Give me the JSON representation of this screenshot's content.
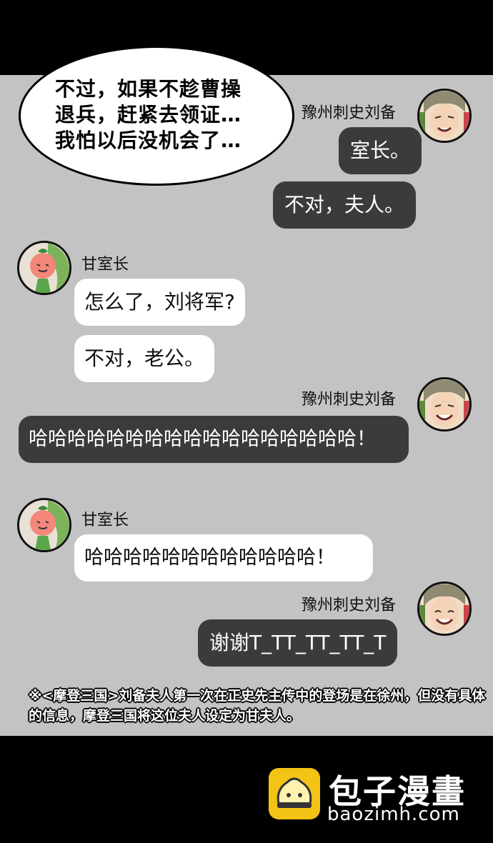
{
  "speech_bubble": {
    "text": "不过，如果不趁曹操\n退兵，赶紧去领证…\n我怕以后没机会了…"
  },
  "chat": {
    "liu_bei_name": "豫州刺史刘备",
    "gan_name": "甘室长",
    "messages": [
      "室长。",
      "不对，夫人。",
      "怎么了，刘将军?",
      "不对，老公。",
      "哈哈哈哈哈哈哈哈哈哈哈哈哈哈哈哈哈！",
      "哈哈哈哈哈哈哈哈哈哈哈哈！",
      "谢谢T_TT_TT_TT_T"
    ]
  },
  "footnote": "※<摩登三国>刘备夫人第一次在正史先主传中的登场是在徐州，但没有具体的信息，摩登三国将这位夫人设定为甘夫人。",
  "watermark": {
    "title": "包子漫畫",
    "url": "baozimh.com"
  }
}
